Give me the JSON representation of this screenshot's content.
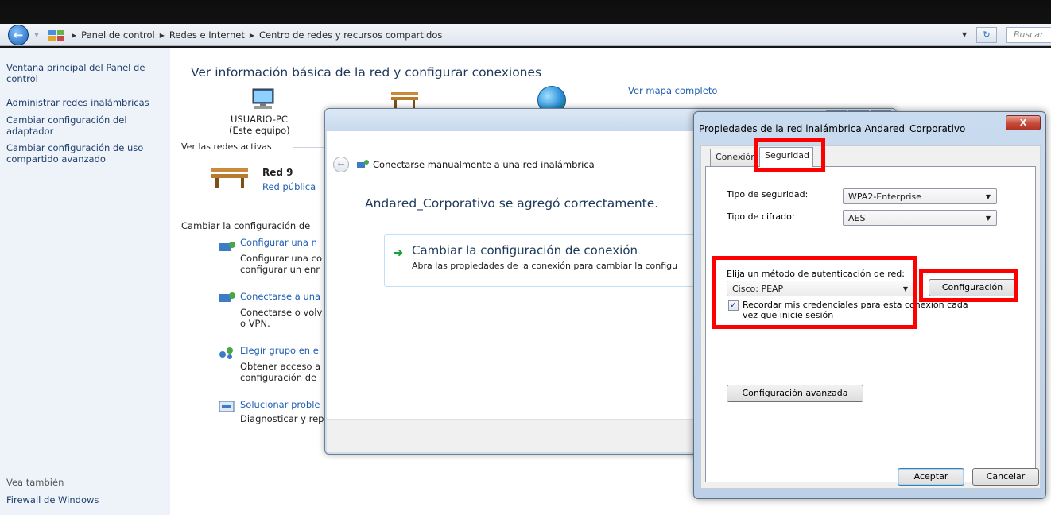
{
  "address_bar": {
    "breadcrumb": [
      "Panel de control",
      "Redes e Internet",
      "Centro de redes y recursos compartidos"
    ],
    "search_placeholder": "Buscar"
  },
  "sidebar": {
    "items": [
      "Ventana principal del Panel de control",
      "Administrar redes inalámbricas",
      "Cambiar configuración del adaptador",
      "Cambiar configuración de uso compartido avanzado"
    ],
    "see_also_label": "Vea también",
    "see_also_items": [
      "Firewall de Windows"
    ]
  },
  "main": {
    "title": "Ver información básica de la red y configurar conexiones",
    "map_link": "Ver mapa completo",
    "computer_name": "USUARIO-PC",
    "computer_sub": "(Este equipo)",
    "active_networks_label": "Ver las redes activas",
    "network_name": "Red 9",
    "network_type": "Red pública",
    "change_settings_label": "Cambiar la configuración de",
    "tasks": [
      {
        "title": "Configurar una n",
        "desc": [
          "Configurar una co",
          "configurar un enr"
        ]
      },
      {
        "title": "Conectarse a una",
        "desc": [
          "Conectarse o volv",
          "o VPN."
        ]
      },
      {
        "title": "Elegir grupo en el",
        "desc": [
          "Obtener acceso a",
          "configuración de"
        ]
      },
      {
        "title": "Solucionar proble",
        "desc": [
          "Diagnosticar y rep"
        ]
      }
    ]
  },
  "wizard": {
    "title": "Conectarse manualmente a una red inalámbrica",
    "success_message": "Andared_Corporativo se agregó correctamente.",
    "option_title": "Cambiar la configuración de conexión",
    "option_desc": "Abra las propiedades de la conexión para cambiar la configu"
  },
  "properties": {
    "title": "Propiedades de la red inalámbrica Andared_Corporativo",
    "close_label": "X",
    "tabs": [
      "Conexión",
      "Seguridad"
    ],
    "security_type_label": "Tipo de seguridad:",
    "security_type_value": "WPA2-Enterprise",
    "encryption_type_label": "Tipo de cifrado:",
    "encryption_type_value": "AES",
    "auth_method_label": "Elija un método de autenticación de red:",
    "auth_method_value": "Cisco: PEAP",
    "settings_button": "Configuración",
    "remember_credentials_line1": "Recordar mis credenciales para esta conexión cada",
    "remember_credentials_line2": "vez que inicie sesión",
    "remember_credentials_checked": true,
    "advanced_button": "Configuración avanzada",
    "ok_button": "Aceptar",
    "cancel_button": "Cancelar"
  },
  "colors": {
    "highlight": "#ff0000",
    "link": "#1f5fb3",
    "heading": "#1e395b"
  }
}
